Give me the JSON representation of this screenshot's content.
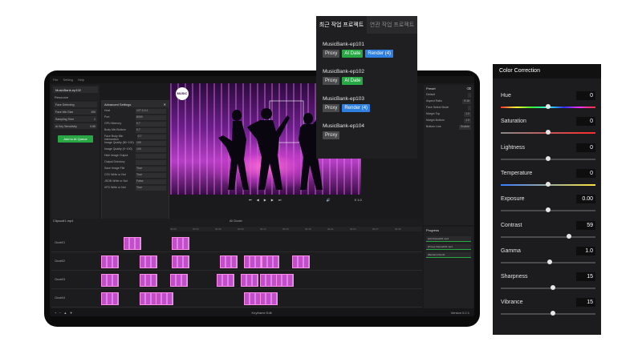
{
  "tablet": {
    "menu": [
      "File",
      "Setting",
      "Help"
    ],
    "project_name": "MusicBank-ep102",
    "resource_label": "Resource",
    "sidebar_rows": [
      {
        "label": "Face Detecting",
        "value": ""
      },
      {
        "label": "Face Min Size",
        "value": "100"
      },
      {
        "label": "Sampling Time",
        "value": "1"
      },
      {
        "label": "Ai Key Sensitivity",
        "value": "0.65"
      }
    ],
    "add_queue_label": "Add to AI Queue",
    "advanced": {
      "title": "Advanced Settings",
      "rows": [
        {
          "label": "Host",
          "value": "127.0.0.1"
        },
        {
          "label": "Port",
          "value": "8000"
        },
        {
          "label": "GPU Memory",
          "value": "0.7"
        },
        {
          "label": "Body Min Bottom",
          "value": "0.7"
        },
        {
          "label": "Face Body Min Intersection",
          "value": "0.7"
        },
        {
          "label": "Image Quality (80~100)",
          "value": "100"
        },
        {
          "label": "Image Quality (0~100)",
          "value": "100"
        },
        {
          "label": "Hide Image Output",
          "value": ""
        },
        {
          "label": "Output Directory",
          "value": ""
        },
        {
          "label": "Save Image File",
          "value": "True"
        },
        {
          "label": "CSV Write or Not",
          "value": "True"
        },
        {
          "label": "JSON Write or Not",
          "value": "False"
        },
        {
          "label": "XFD Write or Not",
          "value": "True"
        }
      ]
    },
    "video_logo": "MUSIC",
    "controls": {
      "zoom": "X 1.0"
    },
    "preset": {
      "title": "Preset",
      "rows": [
        {
          "label": "Default",
          "value": ""
        },
        {
          "label": "Aspect Ratio",
          "value": "9:16"
        },
        {
          "label": "Face Select Mode",
          "value": ""
        },
        {
          "label": "Margin Top",
          "value": "1.0"
        },
        {
          "label": "Margin Bottom",
          "value": "1.0"
        },
        {
          "label": "Bottom Line",
          "value": "Enable"
        }
      ]
    },
    "timeline": {
      "tab": "Clipsodi1.mp4",
      "ruler": [
        "00:00",
        "00:03",
        "00:06",
        "00:09",
        "00:12",
        "00:15",
        "00:18",
        "00:21",
        "00:24",
        "00:27",
        "00:30"
      ],
      "tracks": [
        "Clustr01",
        "Clustr02",
        "Clustr03",
        "Clustr04"
      ],
      "cluster_label": "All Cluster"
    },
    "progress": {
      "title": "Progress",
      "items": [
        "[AI] Clipsodi01.mp4",
        "[Proxy] Clipsodi01.mp4",
        "[Render] Clip 01"
      ]
    },
    "bottom": {
      "center_label": "Keyframe Edit",
      "version": "Version 0.2.1"
    }
  },
  "recent": {
    "tab_active": "최근 작업 프로젝트",
    "tab_inactive": "연관 작업 프로젝트",
    "projects": [
      {
        "name": "MusicBank-ep101",
        "badges": [
          {
            "t": "Proxy",
            "k": "proxy"
          },
          {
            "t": "AI Date",
            "k": "ai"
          },
          {
            "t": "Render (4)",
            "k": "render"
          }
        ]
      },
      {
        "name": "MusicBank-ep102",
        "badges": [
          {
            "t": "Proxy",
            "k": "proxy"
          },
          {
            "t": "AI Date",
            "k": "ai"
          }
        ]
      },
      {
        "name": "MusicBank-ep103",
        "badges": [
          {
            "t": "Proxy",
            "k": "proxy"
          },
          {
            "t": "Render (4)",
            "k": "render"
          }
        ]
      },
      {
        "name": "MusicBank-ep104",
        "badges": [
          {
            "t": "Proxy",
            "k": "proxy"
          }
        ]
      }
    ]
  },
  "color_correction": {
    "title": "Color Correction",
    "controls": [
      {
        "name": "Hue",
        "value": "0",
        "level": 0.5,
        "track": "hue"
      },
      {
        "name": "Saturation",
        "value": "0",
        "level": 0.5,
        "track": "sat"
      },
      {
        "name": "Lightness",
        "value": "0",
        "level": 0.5,
        "track": "gray"
      },
      {
        "name": "Temperature",
        "value": "0",
        "level": 0.5,
        "track": "temp"
      },
      {
        "name": "Exposure",
        "value": "0.00",
        "level": 0.5,
        "track": "gray"
      },
      {
        "name": "Contrast",
        "value": "59",
        "level": 0.72,
        "track": "gray"
      },
      {
        "name": "Gamma",
        "value": "1.0",
        "level": 0.52,
        "track": "gray"
      },
      {
        "name": "Sharpness",
        "value": "15",
        "level": 0.55,
        "track": "gray"
      },
      {
        "name": "Vibrance",
        "value": "15",
        "level": 0.55,
        "track": "gray"
      }
    ]
  },
  "colors": {
    "green": "#28a745",
    "blue": "#2f7fe0",
    "magenta": "#c24fc9"
  }
}
